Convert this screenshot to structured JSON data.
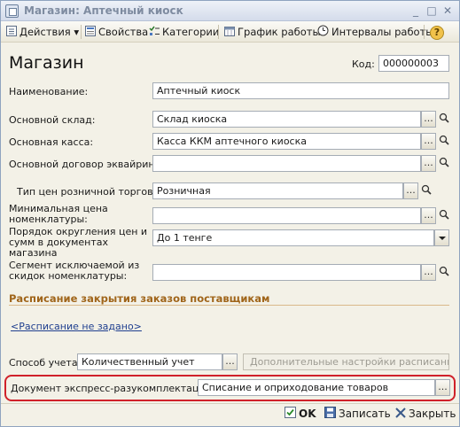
{
  "window": {
    "title": "Магазин: Аптечный киоск"
  },
  "toolbar": {
    "actions": "Действия",
    "properties": "Свойства",
    "categories": "Категории",
    "schedule": "График работы",
    "intervals": "Интервалы работы",
    "help": "?"
  },
  "form": {
    "title": "Магазин",
    "code_label": "Код:",
    "code_value": "000000003",
    "name_label": "Наименование:",
    "name_value": "Аптечный киоск",
    "warehouse_label": "Основной склад:",
    "warehouse_value": "Склад киоска",
    "cashbox_label": "Основная касса:",
    "cashbox_value": "Касса ККМ аптечного киоска",
    "acquiring_label": "Основной договор эквайринга:",
    "acquiring_value": "",
    "price_type_label": "Тип цен розничной торговли:",
    "price_type_value": "Розничная",
    "min_price_label": "Минимальная цена номенклатуры:",
    "min_price_value": "",
    "rounding_label": "Порядок округления цен и сумм в документах магазина",
    "rounding_value": "До 1 тенге",
    "segment_label": "Сегмент исключаемой из скидок номенклатуры:",
    "segment_value": ""
  },
  "schedule_section": {
    "header": "Расписание закрытия заказов поставщикам",
    "link": "<Расписание не задано>"
  },
  "accounting": {
    "method_label": "Способ учета:",
    "method_value": "Количественный учет",
    "extra_settings": "Дополнительные настройки расписания ...",
    "express_doc_label": "Документ экспресс-разукомплектации:",
    "express_doc_value": "Списание и оприходование товаров"
  },
  "footer": {
    "ok": "OK",
    "save": "Записать",
    "close": "Закрыть"
  },
  "colors": {
    "section_header": "#a0651a",
    "highlight": "#d0212a",
    "link": "#1f3f8f"
  }
}
